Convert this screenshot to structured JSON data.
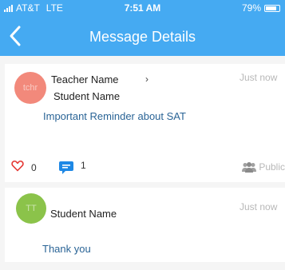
{
  "status_bar": {
    "carrier": "AT&T",
    "network": "LTE",
    "time": "7:51 AM",
    "battery": "79%",
    "battery_level": 0.79
  },
  "nav": {
    "back_icon": "chevron-left-icon",
    "title": "Message Details"
  },
  "message": {
    "sender": "Teacher Name",
    "recipient_arrow": "›",
    "recipient": "Student Name",
    "time": "Just now",
    "body": "Important Reminder about SAT",
    "like_count": "0",
    "comment_count": "1",
    "audience": "Public"
  },
  "reply": {
    "sender": "Student Name",
    "time": "Just now",
    "body": "Thank you"
  },
  "colors": {
    "header": "#45aaf2",
    "heart": "#e53935",
    "comment": "#1e88e5",
    "link_text": "#2a6496"
  }
}
